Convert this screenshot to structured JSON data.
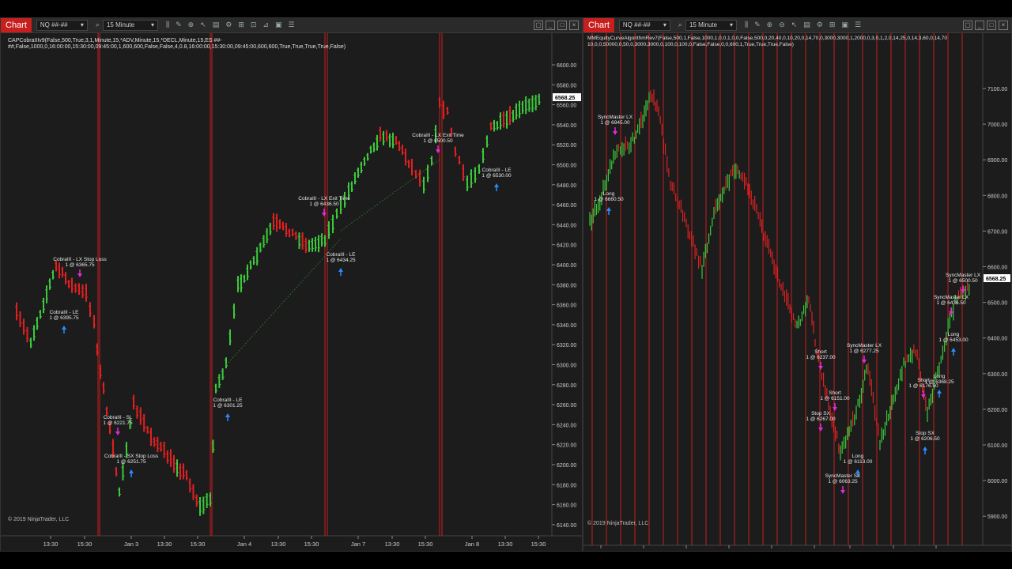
{
  "chart1": {
    "tab_label": "Chart",
    "instrument": "NQ ##-##",
    "interval": "15 Minute",
    "indicator_line1": "CAPCobraIIIv9(False,500,True,3,1,Minute,15,*ADV,Minute,15,*DECL,Minute,15,ES ##-",
    "indicator_line2": "##,False,1000,0,16:00:00,15:30:00,09:45:00,1,600,600,False,False,4,0.8,16:00:00,15:30:00,09:45:00,600,600,True,True,True,True,False)",
    "copyright": "© 2019 NinjaTrader, LLC",
    "price_labels": [
      "6600.00",
      "6580.00",
      "6560.00",
      "6540.00",
      "6520.00",
      "6500.00",
      "6480.00",
      "6460.00",
      "6440.00",
      "6420.00",
      "6400.00",
      "6380.00",
      "6360.00",
      "6340.00",
      "6320.00",
      "6300.00",
      "6280.00",
      "6260.00",
      "6240.00",
      "6220.00",
      "6200.00",
      "6180.00",
      "6160.00",
      "6140.00"
    ],
    "current_price": "6568.25",
    "time_labels": [
      "13:30",
      "15:30",
      "Jan 3",
      "13:30",
      "15:30",
      "Jan 4",
      "13:30",
      "15:30",
      "Jan 7",
      "13:30",
      "15:30",
      "Jan 8",
      "13:30",
      "15:30"
    ],
    "annotations": [
      {
        "line1": "CobraIII - LX Stop Loss",
        "line2": "1 @ 6365.75"
      },
      {
        "line1": "CobraIII - LE",
        "line2": "1 @ 6395.75"
      },
      {
        "line1": "CobraIII - SL",
        "line2": "1 @ 6221.75"
      },
      {
        "line1": "CobraIII - SX Stop Loss",
        "line2": "1 @ 6251.75"
      },
      {
        "line1": "CobraIII - LE",
        "line2": "1 @ 6301.25"
      },
      {
        "line1": "CobraIII - LX Exit Time",
        "line2": "1 @ 6436.50"
      },
      {
        "line1": "CobraIII - LE",
        "line2": "1 @ 6434.25"
      },
      {
        "line1": "CobraIII - LX Exit Time",
        "line2": "1 @ 6500.50"
      },
      {
        "line1": "CobraIII - LE",
        "line2": "1 @ 6530.00"
      }
    ]
  },
  "chart2": {
    "tab_label": "Chart",
    "instrument": "NQ ##-##",
    "interval": "15 Minute",
    "indicator_line1": "MMEquityCurveAlgorithmRev7(False,500,1,False,1000,1,0,0,1,0,0,False,500,0,20,40,0,10,20,0,14,70,0,3000,3000,1,2000,0,3,0,1,2,0,14,25,0,14,3,60,0,14,70",
    "indicator_line2": "10,0,0,50000,0,50,0,3000,3000,0,100,0,100,0,False,False,0,0,600,1,True,True,True,False)",
    "copyright": "© 2019 NinjaTrader, LLC",
    "price_labels": [
      "7100.00",
      "7000.00",
      "6900.00",
      "6800.00",
      "6700.00",
      "6600.00",
      "6500.00",
      "6400.00",
      "6300.00",
      "6200.00",
      "6100.00",
      "6000.00",
      "5900.00"
    ],
    "current_price": "6568.25",
    "time_labels": [
      "Nov 28",
      "Dec 3",
      "Dec 7",
      "Dec 12",
      "Dec 17",
      "Dec 20",
      "Dec 26",
      "Dec 31",
      "Jan 4"
    ],
    "annotations": [
      {
        "line1": "SyncMaster LX",
        "line2": "1 @ 6945.00"
      },
      {
        "line1": "Long",
        "line2": "1 @ 6660.50"
      },
      {
        "line1": "Short",
        "line2": "1 @ 6237.00"
      },
      {
        "line1": "SyncMaster LX",
        "line2": "1 @ 6277.25"
      },
      {
        "line1": "Short",
        "line2": "1 @ 6151.00"
      },
      {
        "line1": "Stop SX",
        "line2": "1 @ 6267.00"
      },
      {
        "line1": "Long",
        "line2": "1 @ 6113.00"
      },
      {
        "line1": "SyncMaster SX",
        "line2": "1 @ 6063.25"
      },
      {
        "line1": "Long",
        "line2": "1 @ 6368.25"
      },
      {
        "line1": "Short",
        "line2": "1 @ 6176.50"
      },
      {
        "line1": "Stop SX",
        "line2": "1 @ 6206.50"
      },
      {
        "line1": "SyncMaster LX",
        "line2": "1 @ 6500.50"
      },
      {
        "line1": "SyncMaster LX",
        "line2": "1 @ 6436.50"
      },
      {
        "line1": "Long",
        "line2": "1 @ 6453.00"
      }
    ]
  },
  "colors": {
    "up": "#3cc83c",
    "down": "#e02020",
    "session_line": "#c81e1e",
    "background": "#1c1c1c",
    "chart_tab": "#c81e1e"
  },
  "icons": [
    "dropdown-icon",
    "search-icon",
    "bar-style-icon",
    "draw-icon",
    "zoom-icon",
    "cursor-icon",
    "properties-icon",
    "strategy-icon",
    "minimize-icon",
    "maximize-icon",
    "close-icon"
  ]
}
